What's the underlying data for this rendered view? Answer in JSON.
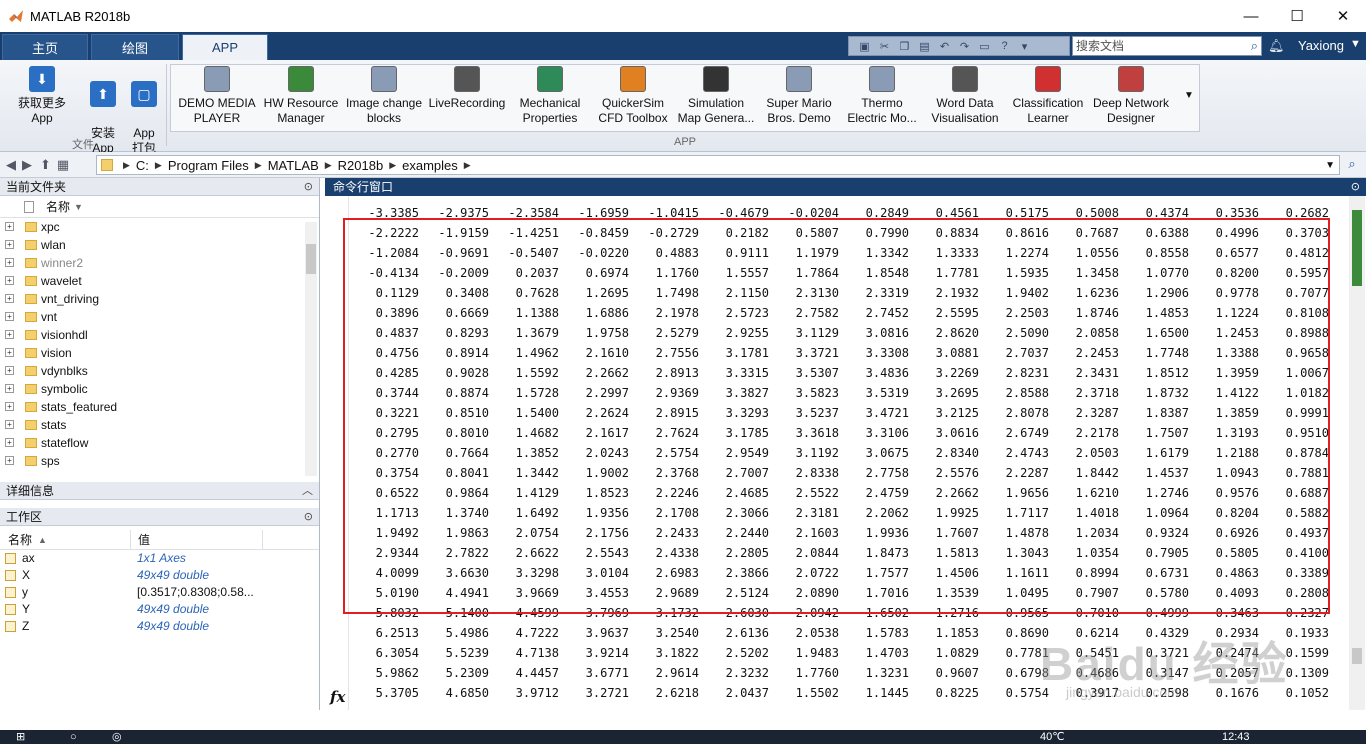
{
  "window": {
    "title": "MATLAB R2018b"
  },
  "tabs": [
    "主页",
    "绘图",
    "APP"
  ],
  "quick_access": {
    "search_placeholder": "搜索文档",
    "user": "Yaxiong"
  },
  "ribbon": {
    "file_buttons": [
      {
        "label": "获取更多 App",
        "icon": "download-icon",
        "color": "#2b6fc4"
      },
      {
        "label": "安装\nApp",
        "icon": "install-app-icon",
        "color": "#2b6fc4"
      },
      {
        "label": "App\n打包",
        "icon": "package-app-icon",
        "color": "#2b6fc4"
      }
    ],
    "file_group_label": "文件",
    "apps": [
      {
        "label": "DEMO MEDIA\nPLAYER",
        "color": "#8a9bb5"
      },
      {
        "label": "HW Resource\nManager",
        "color": "#3a8a3a"
      },
      {
        "label": "Image change\nblocks",
        "color": "#8a9bb5"
      },
      {
        "label": "LiveRecording",
        "color": "#555555"
      },
      {
        "label": "Mechanical\nProperties",
        "color": "#2f8a5a"
      },
      {
        "label": "QuickerSim\nCFD Toolbox",
        "color": "#e08020"
      },
      {
        "label": "Simulation\nMap Genera...",
        "color": "#333333"
      },
      {
        "label": "Super Mario\nBros. Demo",
        "color": "#8a9bb5"
      },
      {
        "label": "Thermo\nElectric Mo...",
        "color": "#8a9bb5"
      },
      {
        "label": "Word Data\nVisualisation",
        "color": "#555555"
      },
      {
        "label": "Classification\nLearner",
        "color": "#d03030"
      },
      {
        "label": "Deep Network\nDesigner",
        "color": "#c04040"
      }
    ],
    "app_group_label": "APP"
  },
  "address": {
    "segments": [
      "C:",
      "Program Files",
      "MATLAB",
      "R2018b",
      "examples"
    ]
  },
  "current_folder": {
    "title": "当前文件夹",
    "column_name": "名称",
    "items": [
      "xpc",
      "wlan",
      "winner2",
      "wavelet",
      "vnt_driving",
      "vnt",
      "visionhdl",
      "vision",
      "vdynblks",
      "symbolic",
      "stats_featured",
      "stats",
      "stateflow",
      "sps"
    ]
  },
  "details": {
    "title": "详细信息"
  },
  "workspace": {
    "title": "工作区",
    "col_name": "名称",
    "col_value": "值",
    "vars": [
      {
        "name": "ax",
        "value": "1x1 Axes",
        "italic": true
      },
      {
        "name": "X",
        "value": "49x49 double",
        "italic": true
      },
      {
        "name": "y",
        "value": "[0.3517;0.8308;0.58...",
        "italic": false
      },
      {
        "name": "Y",
        "value": "49x49 double",
        "italic": true
      },
      {
        "name": "Z",
        "value": "49x49 double",
        "italic": true
      }
    ]
  },
  "command_window": {
    "title": "命令行窗口",
    "rows": [
      [
        "-3.3385",
        "-2.9375",
        "-2.3584",
        "-1.6959",
        "-1.0415",
        "-0.4679",
        "-0.0204",
        "0.2849",
        "0.4561",
        "0.5175",
        "0.5008",
        "0.4374",
        "0.3536",
        "0.2682"
      ],
      [
        "-2.2222",
        "-1.9159",
        "-1.4251",
        "-0.8459",
        "-0.2729",
        "0.2182",
        "0.5807",
        "0.7990",
        "0.8834",
        "0.8616",
        "0.7687",
        "0.6388",
        "0.4996",
        "0.3703"
      ],
      [
        "-1.2084",
        "-0.9691",
        "-0.5407",
        "-0.0220",
        "0.4883",
        "0.9111",
        "1.1979",
        "1.3342",
        "1.3333",
        "1.2274",
        "1.0556",
        "0.8558",
        "0.6577",
        "0.4812"
      ],
      [
        "-0.4134",
        "-0.2009",
        "0.2037",
        "0.6974",
        "1.1760",
        "1.5557",
        "1.7864",
        "1.8548",
        "1.7781",
        "1.5935",
        "1.3458",
        "1.0770",
        "0.8200",
        "0.5957"
      ],
      [
        "0.1129",
        "0.3408",
        "0.7628",
        "1.2695",
        "1.7498",
        "2.1150",
        "2.3130",
        "2.3319",
        "2.1932",
        "1.9402",
        "1.6236",
        "1.2906",
        "0.9778",
        "0.7077"
      ],
      [
        "0.3896",
        "0.6669",
        "1.1388",
        "1.6886",
        "2.1978",
        "2.5723",
        "2.7582",
        "2.7452",
        "2.5595",
        "2.2503",
        "1.8746",
        "1.4853",
        "1.1224",
        "0.8108"
      ],
      [
        "0.4837",
        "0.8293",
        "1.3679",
        "1.9758",
        "2.5279",
        "2.9255",
        "3.1129",
        "3.0816",
        "2.8620",
        "2.5090",
        "2.0858",
        "1.6500",
        "1.2453",
        "0.8988"
      ],
      [
        "0.4756",
        "0.8914",
        "1.4962",
        "2.1610",
        "2.7556",
        "3.1781",
        "3.3721",
        "3.3308",
        "3.0881",
        "2.7037",
        "2.2453",
        "1.7748",
        "1.3388",
        "0.9658"
      ],
      [
        "0.4285",
        "0.9028",
        "1.5592",
        "2.2662",
        "2.8913",
        "3.3315",
        "3.5307",
        "3.4836",
        "3.2269",
        "2.8231",
        "2.3431",
        "1.8512",
        "1.3959",
        "1.0067"
      ],
      [
        "0.3744",
        "0.8874",
        "1.5728",
        "2.2997",
        "2.9369",
        "3.3827",
        "3.5823",
        "3.5319",
        "3.2695",
        "2.8588",
        "2.3718",
        "1.8732",
        "1.4122",
        "1.0182"
      ],
      [
        "0.3221",
        "0.8510",
        "1.5400",
        "2.2624",
        "2.8915",
        "3.3293",
        "3.5237",
        "3.4721",
        "3.2125",
        "2.8078",
        "2.3287",
        "1.8387",
        "1.3859",
        "0.9991"
      ],
      [
        "0.2795",
        "0.8010",
        "1.4682",
        "2.1617",
        "2.7624",
        "3.1785",
        "3.3618",
        "3.3106",
        "3.0616",
        "2.6749",
        "2.2178",
        "1.7507",
        "1.3193",
        "0.9510"
      ],
      [
        "0.2770",
        "0.7664",
        "1.3852",
        "2.0243",
        "2.5754",
        "2.9549",
        "3.1192",
        "3.0675",
        "2.8340",
        "2.4743",
        "2.0503",
        "1.6179",
        "1.2188",
        "0.8784"
      ],
      [
        "0.3754",
        "0.8041",
        "1.3442",
        "1.9002",
        "2.3768",
        "2.7007",
        "2.8338",
        "2.7758",
        "2.5576",
        "2.2287",
        "1.8442",
        "1.4537",
        "1.0943",
        "0.7881"
      ],
      [
        "0.6522",
        "0.9864",
        "1.4129",
        "1.8523",
        "2.2246",
        "2.4685",
        "2.5522",
        "2.4759",
        "2.2662",
        "1.9656",
        "1.6210",
        "1.2746",
        "0.9576",
        "0.6887"
      ],
      [
        "1.1713",
        "1.3740",
        "1.6492",
        "1.9356",
        "2.1708",
        "2.3066",
        "2.3181",
        "2.2062",
        "1.9925",
        "1.7117",
        "1.4018",
        "1.0964",
        "0.8204",
        "0.5882"
      ],
      [
        "1.9492",
        "1.9863",
        "2.0754",
        "2.1756",
        "2.2433",
        "2.2440",
        "2.1603",
        "1.9936",
        "1.7607",
        "1.4878",
        "1.2034",
        "0.9324",
        "0.6926",
        "0.4937"
      ],
      [
        "2.9344",
        "2.7822",
        "2.6622",
        "2.5543",
        "2.4338",
        "2.2805",
        "2.0844",
        "1.8473",
        "1.5813",
        "1.3043",
        "1.0354",
        "0.7905",
        "0.5805",
        "0.4100"
      ],
      [
        "4.0099",
        "3.6630",
        "3.3298",
        "3.0104",
        "2.6983",
        "2.3866",
        "2.0722",
        "1.7577",
        "1.4506",
        "1.1611",
        "0.8994",
        "0.6731",
        "0.4863",
        "0.3389"
      ],
      [
        "5.0190",
        "4.4941",
        "3.9669",
        "3.4553",
        "2.9689",
        "2.5124",
        "2.0890",
        "1.7016",
        "1.3539",
        "1.0495",
        "0.7907",
        "0.5780",
        "0.4093",
        "0.2808"
      ],
      [
        "5.8032",
        "5.1400",
        "4.4599",
        "3.7969",
        "3.1732",
        "2.6030",
        "2.0942",
        "1.6502",
        "1.2716",
        "0.9565",
        "0.7010",
        "0.4999",
        "0.3463",
        "0.2327"
      ],
      [
        "6.2513",
        "5.4986",
        "4.7222",
        "3.9637",
        "3.2540",
        "2.6136",
        "2.0538",
        "1.5783",
        "1.1853",
        "0.8690",
        "0.6214",
        "0.4329",
        "0.2934",
        "0.1933"
      ],
      [
        "6.3054",
        "5.5239",
        "4.7138",
        "3.9214",
        "3.1822",
        "2.5202",
        "1.9483",
        "1.4703",
        "1.0829",
        "0.7781",
        "0.5451",
        "0.3721",
        "0.2474",
        "0.1599"
      ],
      [
        "5.9862",
        "5.2309",
        "4.4457",
        "3.6771",
        "2.9614",
        "2.3232",
        "1.7760",
        "1.3231",
        "0.9607",
        "0.6798",
        "0.4686",
        "0.3147",
        "0.2057",
        "0.1309"
      ],
      [
        "5.3705",
        "4.6850",
        "3.9712",
        "3.2721",
        "2.6218",
        "2.0437",
        "1.5502",
        "1.1445",
        "0.8225",
        "0.5754",
        "0.3917",
        "0.2598",
        "0.1676",
        "0.1052"
      ]
    ]
  },
  "taskbar": {
    "temperature": "40℃",
    "time": "12:43"
  }
}
